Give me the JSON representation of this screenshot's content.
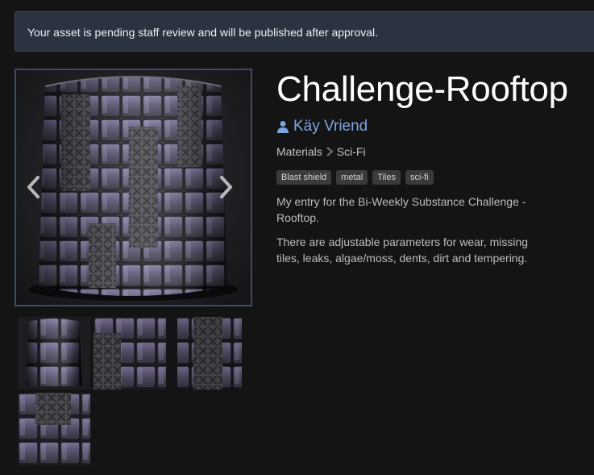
{
  "notice": {
    "text": "Your asset is pending staff review and will be published after approval."
  },
  "asset": {
    "title": "Challenge-Rooftop",
    "author": "Käy Vriend",
    "breadcrumb": {
      "category": "Materials",
      "subcategory": "Sci-Fi"
    },
    "tags": [
      "Blast shield",
      "metal",
      "Tiles",
      "sci-fi"
    ],
    "description": [
      "My entry for the Bi-Weekly Substance Challenge - Rooftop.",
      "There are adjustable parameters for wear, missing tiles, leaks, algae/moss, dents, dirt and tempering."
    ]
  },
  "gallery": {
    "thumbnail_count": 4,
    "icons": {
      "prev": "chevron-left-icon",
      "next": "chevron-right-icon",
      "author": "user-icon",
      "separator": "chevron-right-icon"
    }
  },
  "colors": {
    "background": "#141414",
    "notice_bg": "#2b3340",
    "author_link": "#7ba6e0",
    "tag_bg": "#3a3a3a",
    "hero_border": "#3c4a66"
  }
}
